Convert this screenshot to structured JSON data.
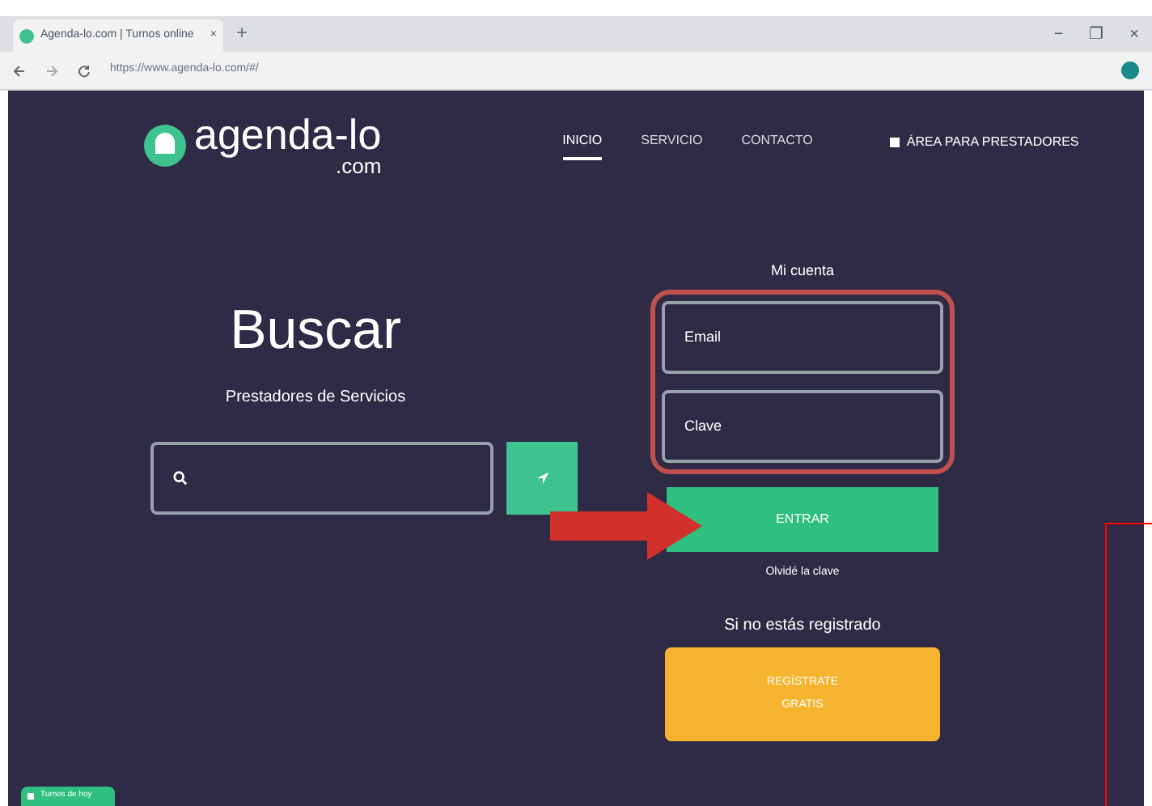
{
  "browser": {
    "tab_title": "Agenda-lo.com | Turnos online",
    "tab_close": "×",
    "new_tab": "+",
    "url": "https://www.agenda-lo.com/#/",
    "controls": [
      "−",
      "❐",
      "×"
    ]
  },
  "header": {
    "logo": "agenda-lo",
    "logo_suffix": ".com",
    "nav": [
      {
        "label": "INICIO",
        "selected": true
      },
      {
        "label": "SERVICIO",
        "selected": false
      },
      {
        "label": "CONTACTO",
        "selected": false
      }
    ],
    "providers_link": "ÁREA PARA PRESTADORES"
  },
  "search": {
    "title": "Buscar",
    "subtitle": "Prestadores de Servicios"
  },
  "account": {
    "title": "Mi cuenta",
    "email_placeholder": "Email",
    "password_placeholder": "Clave",
    "login_button": "ENTRAR",
    "forgot_link": "Olvidé la clave",
    "register_prompt": "Si no estás registrado",
    "register_button": [
      "REGÍSTRATE",
      "GRATIS"
    ]
  },
  "footer_badge": "Turnos de hoy"
}
